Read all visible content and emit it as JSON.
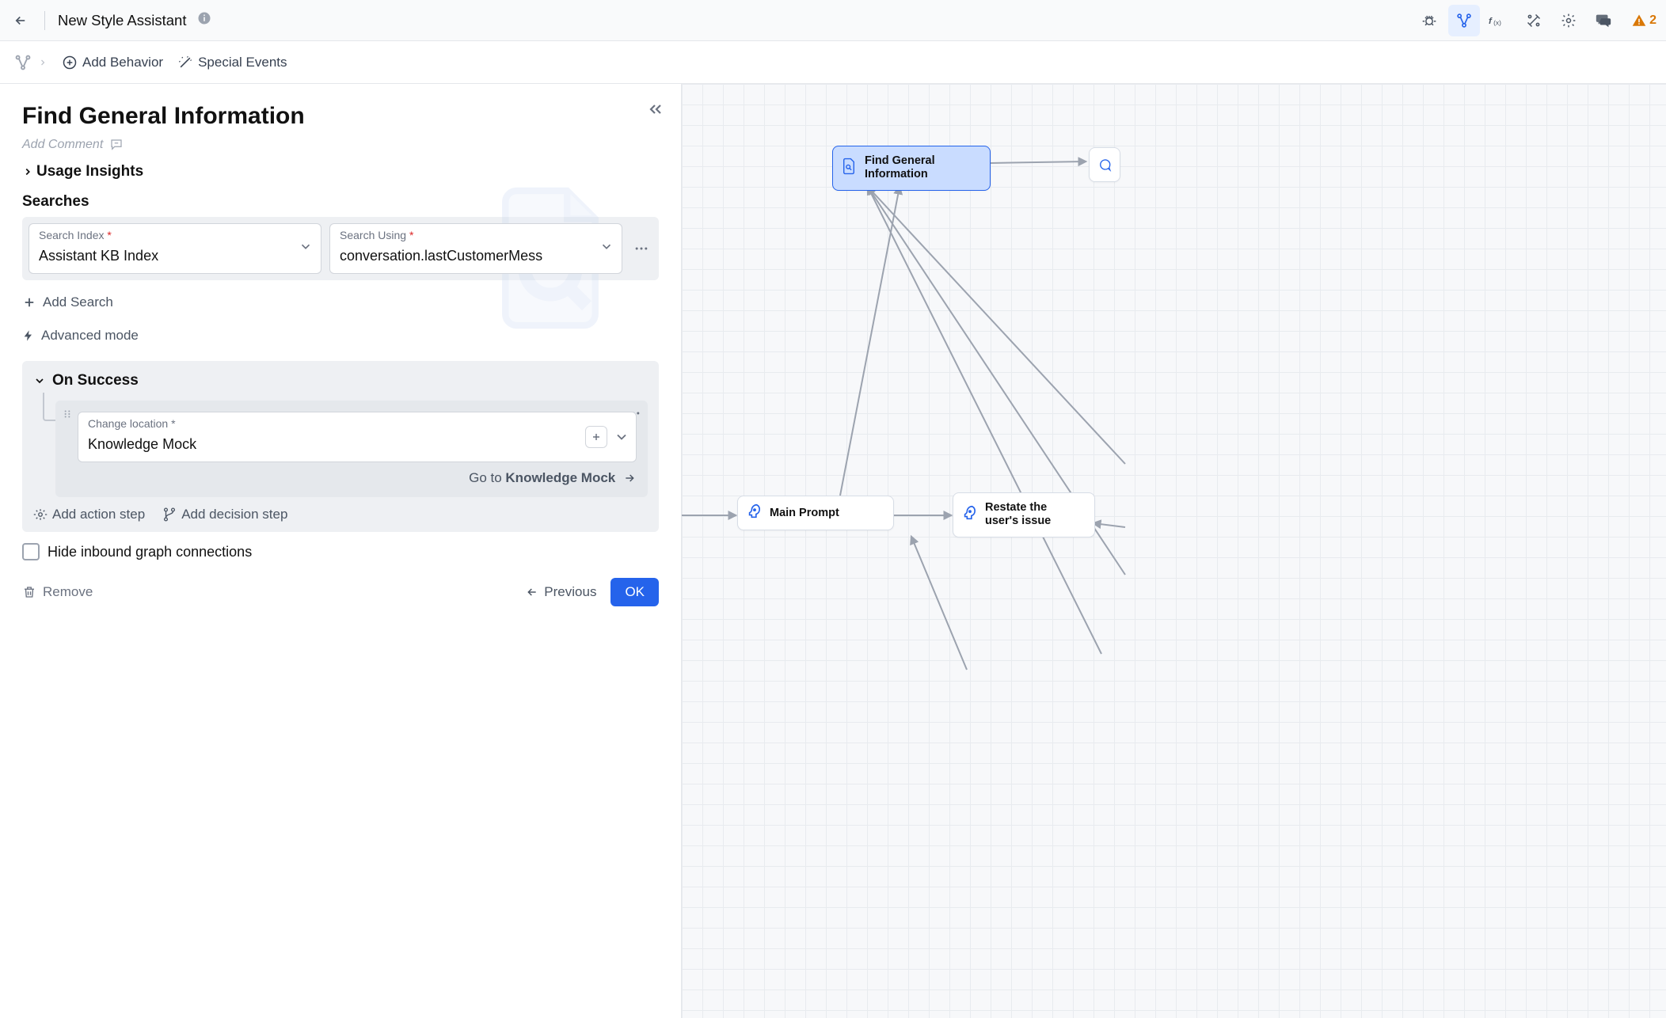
{
  "header": {
    "title": "New Style Assistant",
    "warning_count": "2"
  },
  "subheader": {
    "add_behavior": "Add Behavior",
    "special_events": "Special Events"
  },
  "panel": {
    "title": "Find General Information",
    "add_comment": "Add Comment",
    "usage_insights": "Usage Insights",
    "searches_heading": "Searches",
    "search_index_label": "Search Index",
    "search_index_value": "Assistant KB Index",
    "search_using_label": "Search Using",
    "search_using_value": "conversation.lastCustomerMess",
    "add_search": "Add Search",
    "advanced_mode": "Advanced mode",
    "on_success_heading": "On Success",
    "change_location_label": "Change location",
    "change_location_value": "Knowledge Mock",
    "goto_prefix": "Go to ",
    "goto_target": "Knowledge Mock",
    "add_action_step": "Add action step",
    "add_decision_step": "Add decision step",
    "hide_inbound": "Hide inbound graph connections",
    "remove": "Remove",
    "previous": "Previous",
    "ok": "OK"
  },
  "graph": {
    "node_find": "Find General\nInformation",
    "node_main_prompt": "Main Prompt",
    "node_restate": "Restate the\nuser's issue"
  }
}
